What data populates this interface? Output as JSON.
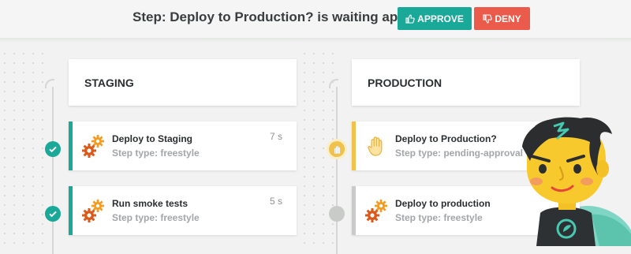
{
  "header": {
    "approval_message": "Step: Deploy to Production? is waiting approval",
    "approve_label": "APPROVE",
    "deny_label": "DENY"
  },
  "colors": {
    "approve": "#1aa898",
    "deny": "#ea5b4c",
    "success": "#1aa898",
    "pending": "#f0c24b",
    "idle": "#c9cbc9"
  },
  "columns": [
    {
      "title": "STAGING",
      "steps": [
        {
          "name": "Deploy to Staging",
          "type": "Step type: freestyle",
          "duration": "7 s",
          "status": "success",
          "icon": "gears-icon"
        },
        {
          "name": "Run smoke tests",
          "type": "Step type: freestyle",
          "duration": "5 s",
          "status": "success",
          "icon": "gears-icon"
        }
      ]
    },
    {
      "title": "PRODUCTION",
      "steps": [
        {
          "name": "Deploy to Production?",
          "type": "Step type: pending-approval",
          "duration": "",
          "status": "pending",
          "icon": "hand-icon"
        },
        {
          "name": "Deploy to production",
          "type": "Step type: freestyle",
          "duration": "",
          "status": "idle",
          "icon": "gears-icon"
        }
      ]
    }
  ]
}
